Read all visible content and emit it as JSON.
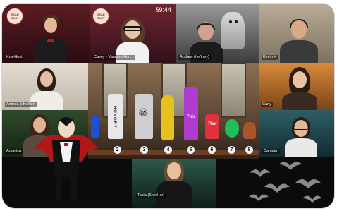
{
  "meeting": {
    "timer": "59:44",
    "brand_line1": "DEAD",
    "brand_line2": "CAST"
  },
  "participants": [
    {
      "name": "Kris-Host"
    },
    {
      "name": "Casey - Vampire Hun..."
    },
    {
      "name": "Andrew (he/they)"
    },
    {
      "name": "Kevin H"
    },
    {
      "name": "Andrea (she/her)"
    },
    {
      "name": "Carly"
    },
    {
      "name": "Angelica"
    },
    {
      "name": "Camden"
    },
    {
      "name": "Tasia (She/Her)"
    }
  ],
  "bottles": [
    {
      "number": "2",
      "label": "HUNGRY",
      "color": "#e8e8ea"
    },
    {
      "number": "3",
      "label": "",
      "color": "#cfcfd1"
    },
    {
      "number": "4",
      "label": "",
      "color": "#e7c21d"
    },
    {
      "number": "5",
      "label": "This",
      "color": "#b03bd0"
    },
    {
      "number": "6",
      "label": "That",
      "color": "#e0313c"
    },
    {
      "number": "7",
      "label": "",
      "color": "#1fbf5a"
    },
    {
      "number": "8",
      "label": "",
      "color": "#a9552b"
    }
  ],
  "icons": {
    "skull": "skull-icon",
    "vampire": "vampire-cartoon",
    "bats": "bat-icon"
  },
  "colors": {
    "frame": "#0b0b0b",
    "accent": "#b21e1e"
  }
}
